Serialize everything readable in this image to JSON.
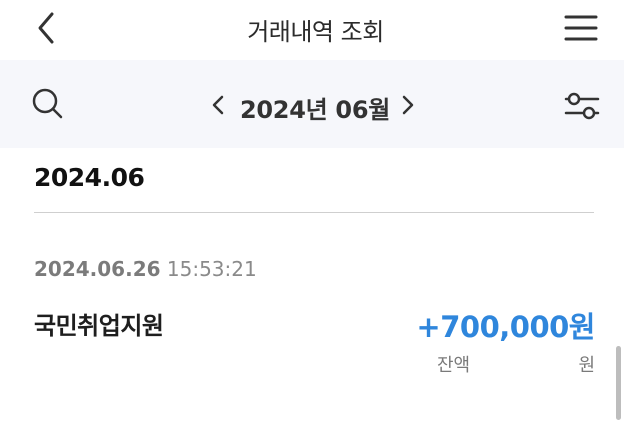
{
  "header": {
    "title": "거래내역 조회",
    "back_icon": "chevron-left-icon",
    "menu_icon": "hamburger-menu-icon"
  },
  "filter": {
    "search_icon": "search-icon",
    "prev_icon": "chevron-left-icon",
    "month": "2024년 06월",
    "next_icon": "chevron-right-icon",
    "settings_icon": "sliders-icon",
    "background": "#f6f7fb"
  },
  "section": {
    "month": "2024.06"
  },
  "transactions": [
    {
      "date": "2024.06.26",
      "time": "15:53:21",
      "name": "국민취업지원",
      "amount": "+700,000원",
      "balance_label": "잔액",
      "balance_unit": "원",
      "amount_color": "#2f86dc"
    }
  ]
}
